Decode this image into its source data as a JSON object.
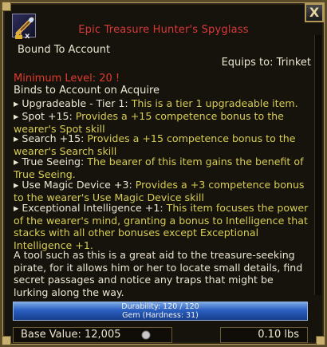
{
  "window": {
    "close_label": "X",
    "title": "Epic Treasure Hunter's Spyglass",
    "item_icon": "spyglass-icon",
    "icon_overlay": "x",
    "colors": {
      "title": "#d83a3a",
      "effect_text": "#d6cd52",
      "body_text": "#ece6d2",
      "bar": "#2a5fc0"
    }
  },
  "item": {
    "bound": "Bound To Account",
    "equips": "Equips to: Trinket",
    "min_level": "Minimum Level: 20 !",
    "binds": "Binds to Account on Acquire",
    "effects": [
      {
        "name": "Upgradeable - Tier 1: ",
        "desc": "This is a tier 1 upgradeable item."
      },
      {
        "name": "Spot +15: ",
        "desc": "Provides a +15 competence bonus to the wearer's Spot skill"
      },
      {
        "name": "Search +15: ",
        "desc": "Provides a +15 competence bonus to the wearer's Search skill"
      },
      {
        "name": "True Seeing: ",
        "desc": "The bearer of this item gains the benefit of True Seeing."
      },
      {
        "name": "Use Magic Device +3: ",
        "desc": "Provides a +3 competence bonus to the wearer's Use Magic Device skill"
      },
      {
        "name": "Exceptional Intelligence +1: ",
        "desc": "This item focuses the power of the wearer's mind, granting a bonus to Intelligence that stacks with all other bonuses except Exceptional Intelligence +1."
      }
    ],
    "lore": "A tool such as this is a great aid to the treasure-seeking pirate, for it allows him or her to locate small details, find secret passages and notice any traps that might be lurking along the way.",
    "durability": "Durability: 120 / 120",
    "durability_fraction": 1.0,
    "gem": "Gem (Hardness: 31)",
    "base_value": "Base Value: 12,005",
    "weight": "0.10 lbs"
  }
}
